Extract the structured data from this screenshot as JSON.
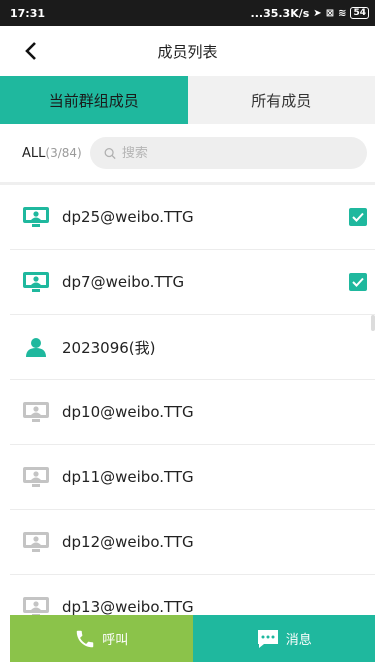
{
  "status_bar": {
    "time": "17:31",
    "network_speed": "...35.3K/s",
    "battery": "54"
  },
  "nav": {
    "title": "成员列表"
  },
  "tabs": [
    {
      "label": "当前群组成员",
      "active": true
    },
    {
      "label": "所有成员",
      "active": false
    }
  ],
  "filter": {
    "all_label": "ALL",
    "count": "(3/84)",
    "search_placeholder": "搜索"
  },
  "members": [
    {
      "name": "dp25@weibo.TTG",
      "icon": "device-icon",
      "online": true,
      "checked": true
    },
    {
      "name": "dp7@weibo.TTG",
      "icon": "device-icon",
      "online": true,
      "checked": true
    },
    {
      "name": "2023096(我)",
      "icon": "user-icon",
      "online": true,
      "checked": false
    },
    {
      "name": "dp10@weibo.TTG",
      "icon": "device-icon",
      "online": false,
      "checked": false
    },
    {
      "name": "dp11@weibo.TTG",
      "icon": "device-icon",
      "online": false,
      "checked": false
    },
    {
      "name": "dp12@weibo.TTG",
      "icon": "device-icon",
      "online": false,
      "checked": false
    },
    {
      "name": "dp13@weibo.TTG",
      "icon": "device-icon",
      "online": false,
      "checked": false
    }
  ],
  "bottom": {
    "call_label": "呼叫",
    "message_label": "消息"
  },
  "colors": {
    "accent": "#1fb89e",
    "call": "#8bc34a",
    "offline_icon": "#c4c4c4"
  }
}
